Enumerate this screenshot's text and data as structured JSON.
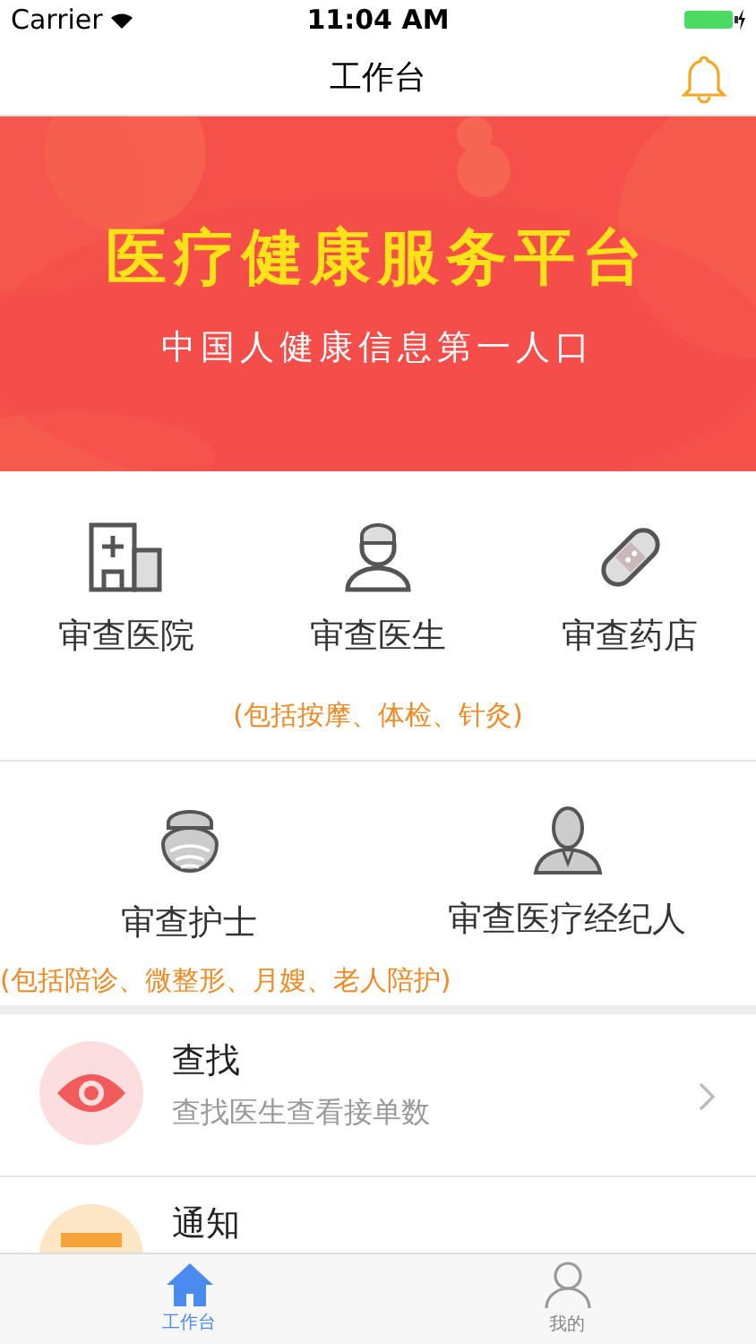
{
  "status_bar": {
    "carrier": "Carrier",
    "time": "11:04 AM"
  },
  "nav": {
    "title": "工作台"
  },
  "banner": {
    "title": "医疗健康服务平台",
    "subtitle": "中国人健康信息第一人口"
  },
  "service_rows": [
    {
      "items": [
        {
          "kind": "hospital",
          "label": "审查医院"
        },
        {
          "kind": "doctor",
          "label": "审查医生"
        },
        {
          "kind": "pill",
          "label": "审查药店"
        }
      ],
      "note": "(包括按摩、体检、针灸)"
    },
    {
      "items": [
        {
          "kind": "nurse",
          "label": "审查护士"
        },
        {
          "kind": "agent",
          "label": "审查医疗经纪人"
        }
      ],
      "note": "(包括陪诊、微整形、月嫂、老人陪护)"
    }
  ],
  "list": [
    {
      "kind": "eye",
      "title": "查找",
      "subtitle": "查找医生查看接单数"
    },
    {
      "kind": "notice",
      "title": "通知"
    }
  ],
  "tabs": [
    {
      "kind": "home",
      "label": "工作台",
      "selected": true
    },
    {
      "kind": "person",
      "label": "我的",
      "selected": false
    }
  ]
}
